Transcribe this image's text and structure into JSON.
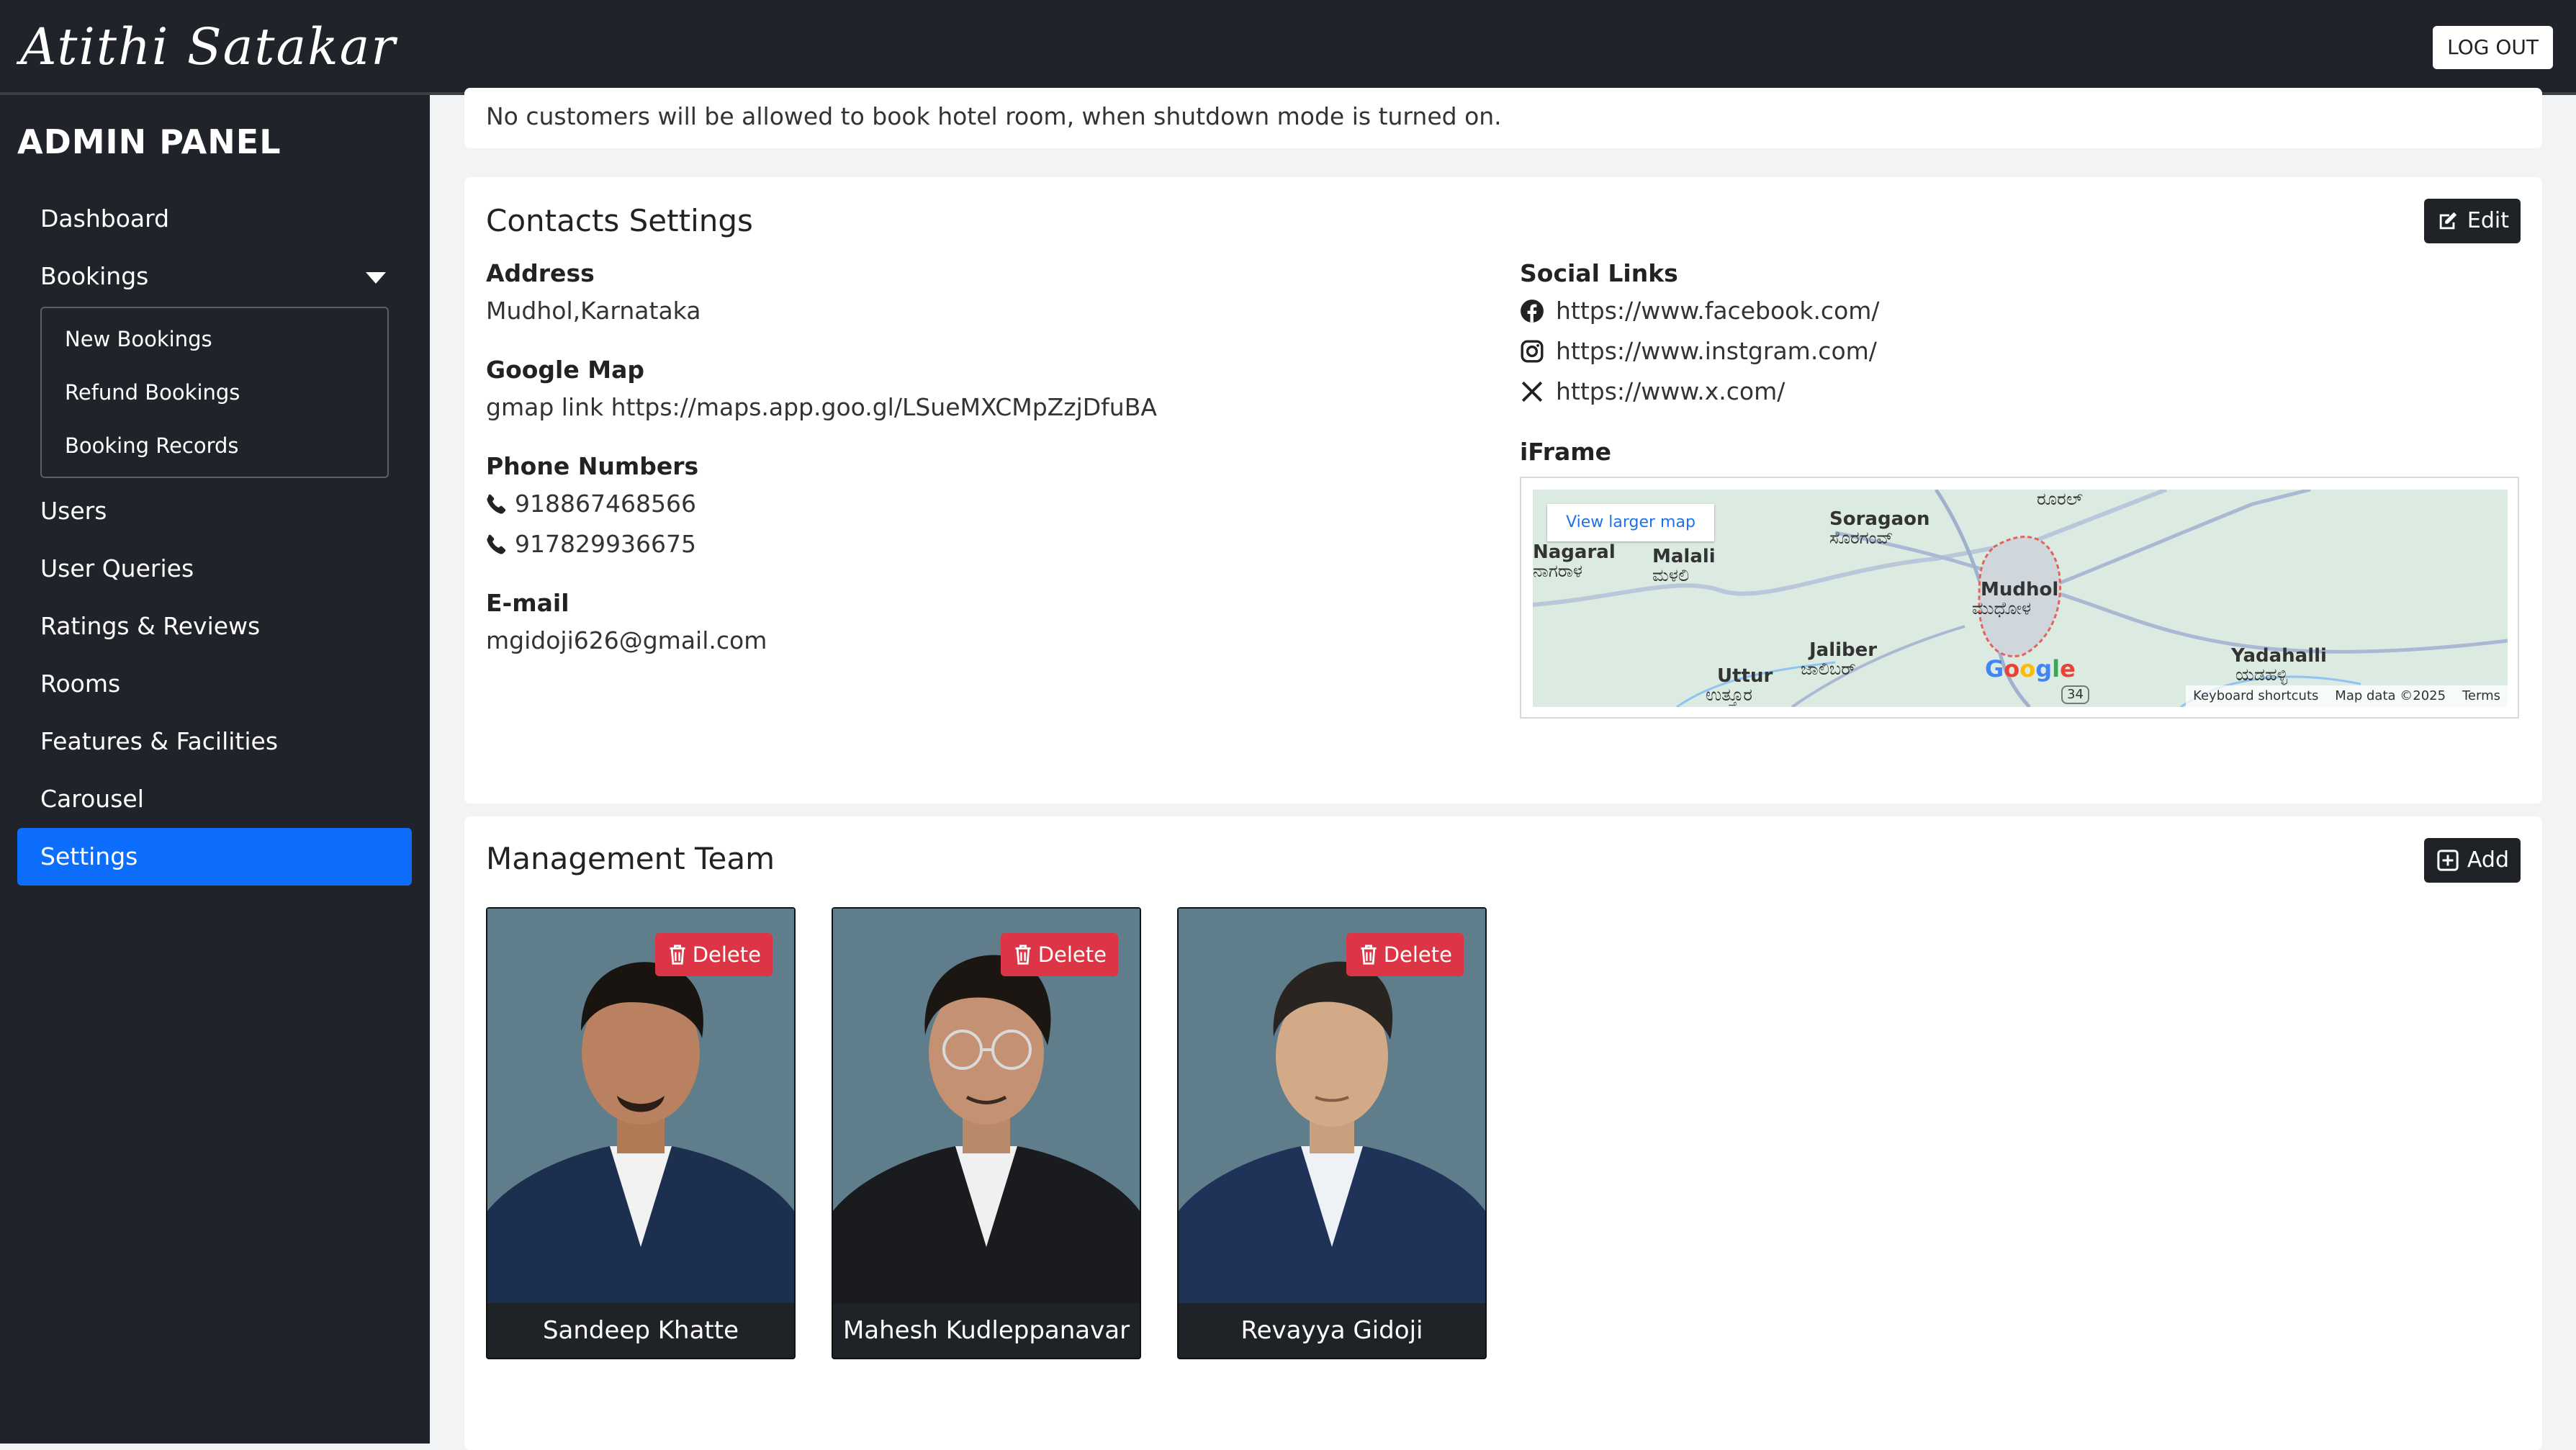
{
  "header": {
    "brand": "Atithi Satakar",
    "logout_label": "LOG OUT"
  },
  "sidebar": {
    "title": "ADMIN PANEL",
    "items": {
      "dashboard": "Dashboard",
      "bookings": "Bookings",
      "new_bookings": "New Bookings",
      "refund_bookings": "Refund Bookings",
      "booking_records": "Booking Records",
      "users": "Users",
      "user_queries": "User Queries",
      "ratings": "Ratings & Reviews",
      "rooms": "Rooms",
      "features": "Features & Facilities",
      "carousel": "Carousel",
      "settings": "Settings"
    },
    "active": "Settings",
    "active_color": "#0d6efd"
  },
  "shutdown": {
    "note": "No customers will be allowed to book hotel room, when shutdown mode is turned on."
  },
  "contacts": {
    "title": "Contacts Settings",
    "edit_label": "Edit",
    "address_label": "Address",
    "address": "Mudhol,Karnataka",
    "gmap_label": "Google Map",
    "gmap": "gmap link https://maps.app.goo.gl/LSueMXCMpZzjDfuBA",
    "phone_label": "Phone Numbers",
    "phones": [
      "918867468566",
      "917829936675"
    ],
    "email_label": "E-mail",
    "email": "mgidoji626@gmail.com",
    "social_label": "Social Links",
    "social": {
      "facebook": "https://www.facebook.com/",
      "instagram": "https://www.instgram.com/",
      "x": "https://www.x.com/"
    },
    "iframe_label": "iFrame",
    "map": {
      "larger_map": "View larger map",
      "places": {
        "soragaon": "Soragaon",
        "soragaon_kn": "ಸೊರಗಂವ್",
        "nagaral": "Nagaral",
        "nagaral_kn": "ನಾಗರಾಳ",
        "malali": "Malali",
        "malali_kn": "ಮಳಲಿ",
        "mudhol": "Mudhol",
        "mudhol_kn": "ಮುಧೋಳ",
        "jaliber": "Jaliber",
        "jaliber_kn": "ಜಾಲಿಬರ್",
        "uttur": "Uttur",
        "uttur_kn": "ಉತ್ತೂರ",
        "yadahalli": "Yadahalli",
        "yadahalli_kn": "ಯಡಹಳ್ಳಿ",
        "top_kn": "ರೂರಲ್",
        "route": "34"
      },
      "google": "Google",
      "shortcuts": "Keyboard shortcuts",
      "map_data": "Map data ©2025",
      "terms": "Terms"
    }
  },
  "team": {
    "title": "Management Team",
    "add_label": "Add",
    "delete_label": "Delete",
    "members": [
      {
        "name": "Sandeep Khatte"
      },
      {
        "name": "Mahesh Kudleppanavar"
      },
      {
        "name": "Revayya Gidoji"
      }
    ]
  }
}
